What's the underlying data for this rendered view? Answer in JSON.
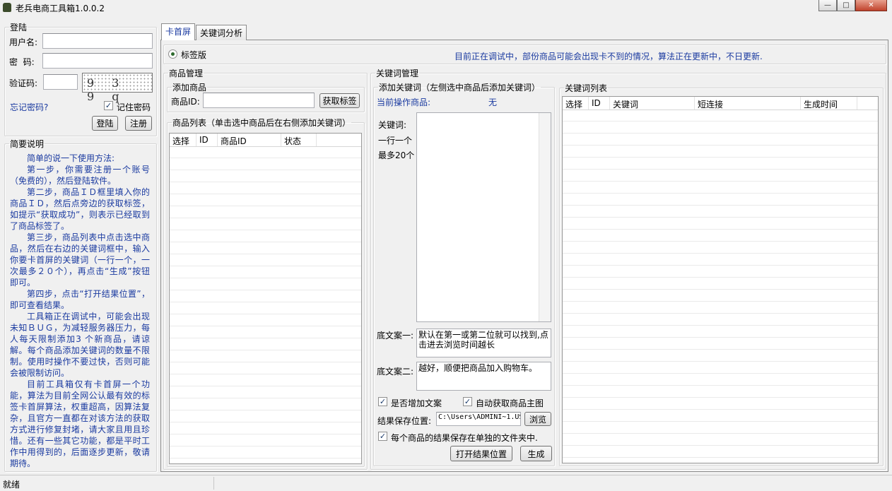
{
  "window": {
    "title": "老兵电商工具箱1.0.0.2",
    "minimize": "—",
    "maximize": "□",
    "close": "✕"
  },
  "login": {
    "legend": "登陆",
    "username_label": "用户名:",
    "username_value": "",
    "password_label": "密  码:",
    "password_value": "",
    "captcha_label": "验证码:",
    "captcha_value": "",
    "captcha_image_text": "9 3  9 q",
    "forgot": "忘记密码?",
    "remember_label": "记住密码",
    "remember_checked": true,
    "login_button": "登陆",
    "register_button": "注册"
  },
  "help": {
    "legend": "简要说明",
    "paragraphs": [
      "简单的说一下使用方法:",
      "第一步，你需要注册一个账号（免费的），然后登陆软件。",
      "第二步，商品ＩＤ框里填入你的商品ＩＤ，然后点旁边的获取标签，如提示“获取成功”，则表示已经取到了商品标签了。",
      "第三步，商品列表中点击选中商品，然后在右边的关键词框中，输入你要卡首屏的关键词（一行一个，一次最多２０个），再点击“生成”按钮即可。",
      "第四步，点击“打开结果位置”，即可查看结果。",
      "工具箱正在调试中，可能会出现未知ＢＵＧ，为减轻服务器压力，每人每天限制添加3 个新商品，请谅解。每个商品添加关键词的数量不限制。使用时操作不要过快，否则可能会被限制访问。",
      "目前工具箱仅有卡首屏一个功能，算法为目前全网公认最有效的标签卡首屏算法，权重超高，因算法复杂，且官方一直都在对该方法的获取方式进行修复封堵，请大家且用且珍惜。还有一些其它功能，都是平时工作中用得到的，后面逐步更新，敬请期待。"
    ]
  },
  "tabs": [
    {
      "label": "卡首屏",
      "active": true
    },
    {
      "label": "关键词分析",
      "active": false
    }
  ],
  "mode": {
    "radio_label": "标签版",
    "notice": "目前正在调试中，部份商品可能会出现卡不到的情况，算法正在更新中，不日更新."
  },
  "product_mgmt": {
    "legend": "商品管理",
    "add_legend": "添加商品",
    "id_label": "商品ID:",
    "id_value": "",
    "fetch_button": "获取标签",
    "list_legend": "商品列表（单击选中商品后在右侧添加关键词）",
    "columns": [
      "选择",
      "ID",
      "商品ID",
      "状态"
    ]
  },
  "keyword_mgmt": {
    "legend": "关键词管理",
    "add_legend": "添加关键词（左侧选中商品后添加关键词）",
    "current_label": "当前操作商品:",
    "current_value": "无",
    "kw_label": "关键词:",
    "kw_hint1": "一行一个",
    "kw_hint2": "最多20个",
    "keywords_value": "",
    "footer1_label": "底文案一:",
    "footer1_value": "默认在第一或第二位就可以找到,点击进去浏览时间越长",
    "footer2_label": "底文案二:",
    "footer2_value": "越好，顺便把商品加入购物车。",
    "add_copy_label": "是否增加文案",
    "add_copy_checked": true,
    "auto_img_label": "自动获取商品主图",
    "auto_img_checked": true,
    "save_label": "结果保存位置:",
    "save_path": "C:\\Users\\ADMINI~1.US",
    "browse_button": "浏览",
    "separate_label": "每个商品的结果保存在单独的文件夹中.",
    "separate_checked": true,
    "open_button": "打开结果位置",
    "generate_button": "生成"
  },
  "keyword_list": {
    "legend": "关键词列表",
    "columns": [
      "选择",
      "ID",
      "关键词",
      "短连接",
      "生成时间"
    ]
  },
  "status": {
    "text": "就绪"
  }
}
